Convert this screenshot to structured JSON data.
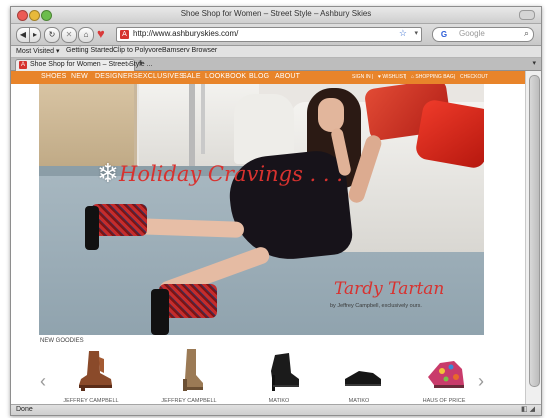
{
  "window": {
    "title": "Shoe Shop for Women – Street Style – Ashbury Skies"
  },
  "toolbar": {
    "back_icon": "back-arrow-icon",
    "forward_icon": "forward-arrow-icon",
    "url": "http://www.ashburyskies.com/",
    "search_placeholder": "Google",
    "search_engine_glyph": "G"
  },
  "bookmarks": [
    "Most Visited ▾",
    "Getting Started",
    "Clip to Polyvore",
    "Bamserv Browser"
  ],
  "tabs": [
    {
      "label": "Shoe Shop for Women – Street Style ..."
    }
  ],
  "site_nav": {
    "items": [
      "SHOES",
      "NEW",
      "DESIGNERS",
      "EXCLUSIVES",
      "SALE",
      "LOOKBOOK",
      "BLOG",
      "ABOUT"
    ],
    "right": [
      "SIGN IN",
      "|",
      "♥ WISHLIST",
      "|",
      "⌂ SHOPPING BAG",
      "|",
      "CHECKOUT"
    ],
    "accent_color": "#e8842a"
  },
  "hero": {
    "headline": "Holiday Cravings . . .",
    "product_title": "Tardy Tartan",
    "byline": "by Jeffrey Campbell, exclusively ours.",
    "headline_color": "#d8322f"
  },
  "goodies": {
    "title": "NEW GOODIES",
    "products": [
      {
        "label": "JEFFREY CAMPBELL"
      },
      {
        "label": "JEFFREY CAMPBELL"
      },
      {
        "label": "MATIKO"
      },
      {
        "label": "MATIKO"
      },
      {
        "label": "HAUS OF PRICE"
      }
    ]
  },
  "status": {
    "text": "Done"
  }
}
